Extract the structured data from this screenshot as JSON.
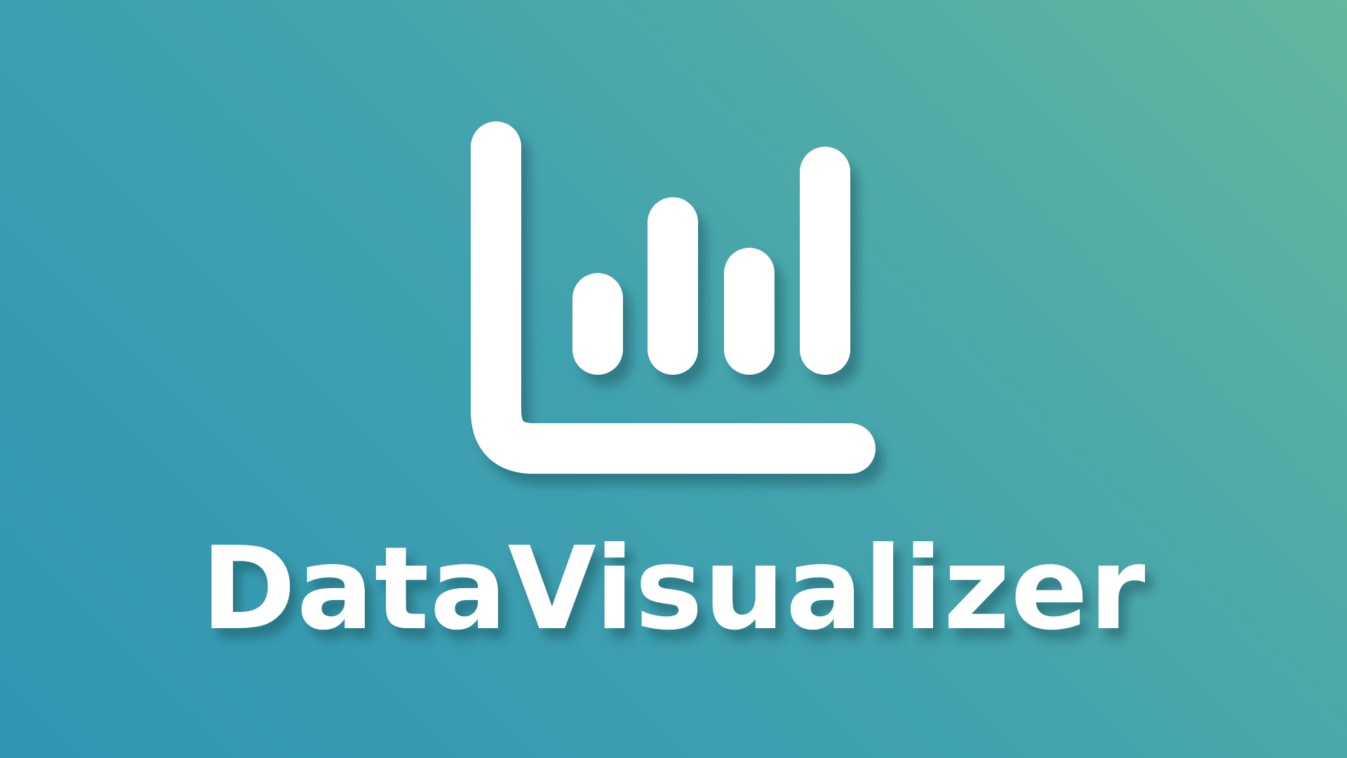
{
  "app": {
    "name": "DataVisualizer",
    "logo_icon": "bar-chart-icon",
    "text_color": "#ffffff",
    "background_gradient": [
      "#2f96b2",
      "#62b79d"
    ]
  }
}
